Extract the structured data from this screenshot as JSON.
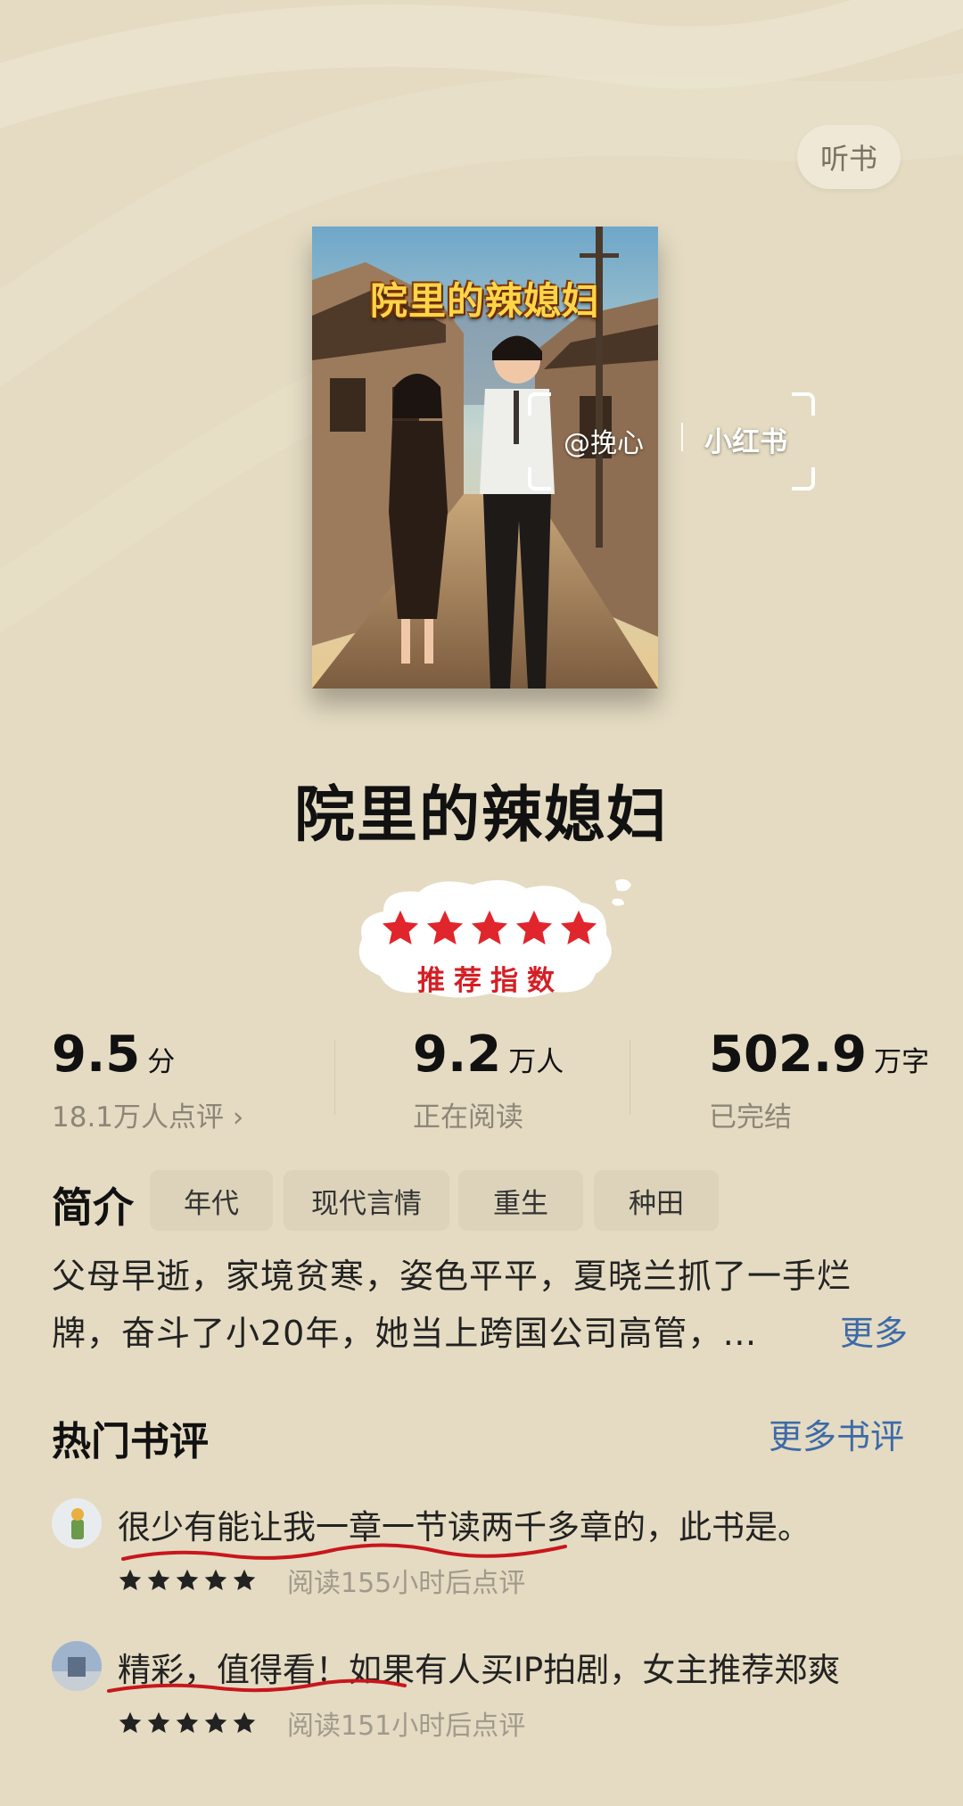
{
  "header": {
    "listen_label": "听书"
  },
  "cover": {
    "title": "院里的辣媳妇"
  },
  "watermark": {
    "user": "@挽心",
    "brand": "小红书"
  },
  "book": {
    "title": "院里的辣媳妇"
  },
  "recommend": {
    "stars": 5,
    "label": "推荐指数",
    "star_color": "#e0262c"
  },
  "stats": {
    "score": {
      "value": "9.5",
      "unit": "分",
      "sub": "18.1万人点评 ›"
    },
    "readers": {
      "value": "9.2",
      "unit": "万人",
      "sub": "正在阅读"
    },
    "words": {
      "value": "502.9",
      "unit": "万字",
      "sub": "已完结"
    }
  },
  "intro": {
    "label": "简介",
    "tags": [
      "年代",
      "现代言情",
      "重生",
      "种田"
    ],
    "line1": "父母早逝，家境贫寒，姿色平平，夏晓兰抓了一手烂",
    "line2": "牌，奋斗了小20年，她当上跨国公司高管，…",
    "more": "更多"
  },
  "reviews": {
    "title": "热门书评",
    "more": "更多书评",
    "items": [
      {
        "text": "很少有能让我一章一节读两千多章的，此书是。",
        "rating": 5,
        "meta": "阅读155小时后点评"
      },
      {
        "text": "精彩，值得看！如果有人买IP拍剧，女主推荐郑爽",
        "rating": 5,
        "meta": "阅读151小时后点评"
      }
    ]
  },
  "colors": {
    "background": "#e4dbc2",
    "link": "#3d6aa8",
    "accent_red": "#d41f25"
  }
}
